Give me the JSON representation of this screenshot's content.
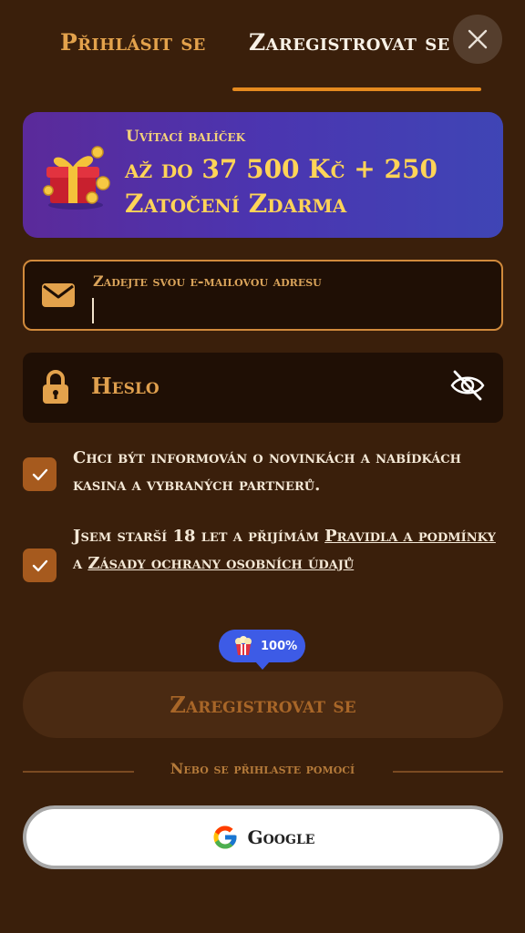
{
  "tabs": {
    "login": "Přihlásit se",
    "register": "Zaregistrovat se"
  },
  "banner": {
    "subtitle": "Uvítací balíček",
    "line1": "až do 37 500 Kč + 250",
    "line2": "Zatočení Zdarma"
  },
  "email": {
    "label": "Zadejte svou e-mailovou adresu",
    "value": ""
  },
  "password": {
    "label": "Heslo"
  },
  "consents": {
    "newsletter": "Chci být informován o novinkách a nabídkách kasina a vybraných partnerů.",
    "age_prefix": "Jsem starší 18 let a přijímám ",
    "terms_link": "Pravidla a podmínky",
    "age_middle": " a ",
    "privacy_link": "Zásady ochrany osobních údajů"
  },
  "progress_badge": "100%",
  "submit_label": "Zaregistrovat se",
  "divider_text": "Nebo se přihlaste pomocí",
  "google_label": "Google",
  "colors": {
    "background": "#3a1f0b",
    "accent": "#e58a1f",
    "banner_gradient_start": "#5b2a9a",
    "banner_gradient_end": "#3f45b5",
    "badge": "#3d5be6"
  },
  "icons": [
    "close-icon",
    "gift-icon",
    "mail-icon",
    "lock-icon",
    "eye-off-icon",
    "check-icon",
    "popcorn-icon",
    "google-icon"
  ]
}
